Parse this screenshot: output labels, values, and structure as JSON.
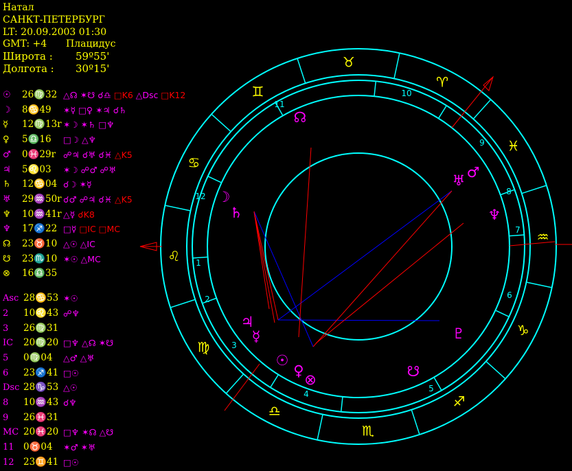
{
  "header": {
    "chart_kind": "Натал",
    "city": "САНКТ-ПЕТЕРБУРГ",
    "lt": "LT: 20.09.2003  01:30",
    "gmt": "GMT: +4",
    "house_system": "Плацидус",
    "lat_label": "Широта :",
    "lat_value": "59º55'",
    "lon_label": "Долгота :",
    "lon_value": "30º15'"
  },
  "planets": [
    {
      "glyph": "☉",
      "pos": "26♍32",
      "color": "#ff00ff",
      "aspects": [
        [
          "△☊",
          "#ff00ff"
        ],
        [
          "✶☋",
          "#ff00ff"
        ],
        [
          "☌♎",
          "#ff00ff"
        ],
        [
          "□K6",
          "#ff0000"
        ],
        [
          "△Dsc",
          "#ff00ff"
        ],
        [
          "□K12",
          "#ff0000"
        ]
      ]
    },
    {
      "glyph": "☽",
      "pos": "8♋49",
      "color": "#ff00ff",
      "aspects": [
        [
          "✶☿",
          "#ff00ff"
        ],
        [
          "□♀",
          "#ff00ff"
        ],
        [
          "✶♃",
          "#ff00ff"
        ],
        [
          "☌♄",
          "#ff00ff"
        ]
      ]
    },
    {
      "glyph": "☿",
      "pos": "12♍13r",
      "color": "#ffff00",
      "aspects": [
        [
          "✶☽",
          "#ff00ff"
        ],
        [
          "✶♄",
          "#ff00ff"
        ],
        [
          "□♆",
          "#ff00ff"
        ]
      ]
    },
    {
      "glyph": "♀",
      "pos": "5♎16",
      "color": "#ffff00",
      "aspects": [
        [
          "□☽",
          "#ff00ff"
        ],
        [
          "△♆",
          "#ff00ff"
        ]
      ]
    },
    {
      "glyph": "♂",
      "pos": "0♓29r",
      "color": "#ff00ff",
      "aspects": [
        [
          "☍♃",
          "#ff00ff"
        ],
        [
          "☌♅",
          "#ff00ff"
        ],
        [
          "☌♓",
          "#ff00ff"
        ],
        [
          "△K5",
          "#ff0000"
        ]
      ]
    },
    {
      "glyph": "♃",
      "pos": "5♌03",
      "color": "#ff00ff",
      "aspects": [
        [
          "✶☽",
          "#ff00ff"
        ],
        [
          "☍♂",
          "#ff00ff"
        ],
        [
          "☍♅",
          "#ff00ff"
        ]
      ]
    },
    {
      "glyph": "♄",
      "pos": "12♋04",
      "color": "#ffff00",
      "aspects": [
        [
          "☌☽",
          "#ff00ff"
        ],
        [
          "✶☿",
          "#ff00ff"
        ]
      ]
    },
    {
      "glyph": "♅",
      "pos": "29♒50r",
      "color": "#ff00ff",
      "aspects": [
        [
          "☌♂",
          "#ff00ff"
        ],
        [
          "☍♃",
          "#ff00ff"
        ],
        [
          "☌♓",
          "#ff00ff"
        ],
        [
          "△K5",
          "#ff0000"
        ]
      ]
    },
    {
      "glyph": "♆",
      "pos": "10♒41r",
      "color": "#ffff00",
      "aspects": [
        [
          "△☿",
          "#ff00ff"
        ],
        [
          "☌K8",
          "#ff0000"
        ]
      ]
    },
    {
      "glyph": "♆",
      "pos": "17♐22",
      "color": "#ff00ff",
      "aspects": [
        [
          "□☿",
          "#ff00ff"
        ],
        [
          "□IC",
          "#ff0000"
        ],
        [
          "□MC",
          "#ff0000"
        ]
      ]
    },
    {
      "glyph": "☊",
      "pos": "23♉10",
      "color": "#ffff00",
      "aspects": [
        [
          "△☉",
          "#ff00ff"
        ],
        [
          "△IC",
          "#ff00ff"
        ]
      ]
    },
    {
      "glyph": "☋",
      "pos": "23♏10",
      "color": "#ffff00",
      "aspects": [
        [
          "✶☉",
          "#ff00ff"
        ],
        [
          "△MC",
          "#ff00ff"
        ]
      ]
    },
    {
      "glyph": "⊗",
      "pos": "16♎35",
      "color": "#ffff00",
      "aspects": []
    }
  ],
  "cusps": [
    {
      "label": "Asc",
      "pos": "28♋53",
      "color": "#ff00ff",
      "aspects": [
        [
          "✶☉",
          "#ff00ff"
        ]
      ]
    },
    {
      "label": "2",
      "pos": "10♌43",
      "color": "#ff00ff",
      "aspects": [
        [
          "☍♆",
          "#ff00ff"
        ]
      ]
    },
    {
      "label": "3",
      "pos": "26♍31",
      "color": "#ff00ff",
      "aspects": []
    },
    {
      "label": "IC",
      "pos": "20♍20",
      "color": "#ff00ff",
      "aspects": [
        [
          "□♆",
          "#ff00ff"
        ],
        [
          "△☊",
          "#ff00ff"
        ],
        [
          "✶☋",
          "#ff00ff"
        ]
      ]
    },
    {
      "label": "5",
      "pos": "0♍04",
      "color": "#ff00ff",
      "aspects": [
        [
          "△♂",
          "#ff00ff"
        ],
        [
          "△♅",
          "#ff00ff"
        ]
      ]
    },
    {
      "label": "6",
      "pos": "23♐41",
      "color": "#ff00ff",
      "aspects": [
        [
          "□☉",
          "#ff00ff"
        ]
      ]
    },
    {
      "label": "Dsc",
      "pos": "28♑53",
      "color": "#ff00ff",
      "aspects": [
        [
          "△☉",
          "#ff00ff"
        ]
      ]
    },
    {
      "label": "8",
      "pos": "10♒43",
      "color": "#ff00ff",
      "aspects": [
        [
          "☌♆",
          "#ff00ff"
        ]
      ]
    },
    {
      "label": "9",
      "pos": "26♓31",
      "color": "#ff00ff",
      "aspects": []
    },
    {
      "label": "MC",
      "pos": "20♓20",
      "color": "#ff00ff",
      "aspects": [
        [
          "□♆",
          "#ff00ff"
        ],
        [
          "✶☊",
          "#ff00ff"
        ],
        [
          "△☋",
          "#ff00ff"
        ]
      ]
    },
    {
      "label": "11",
      "pos": "0♉04",
      "color": "#ff00ff",
      "aspects": [
        [
          "✶♂",
          "#ff00ff"
        ],
        [
          "✶♅",
          "#ff00ff"
        ]
      ]
    },
    {
      "label": "12",
      "pos": "23♊41",
      "color": "#ff00ff",
      "aspects": [
        [
          "□☉",
          "#ff00ff"
        ]
      ]
    }
  ],
  "wheel": {
    "signs": [
      {
        "glyph": "♉",
        "color": "#ffff00"
      },
      {
        "glyph": "♈",
        "color": "#ffff00"
      },
      {
        "glyph": "♓",
        "color": "#ffff00"
      },
      {
        "glyph": "♒",
        "color": "#ffff00"
      },
      {
        "glyph": "♑",
        "color": "#ffff00"
      },
      {
        "glyph": "♐",
        "color": "#ffff00"
      },
      {
        "glyph": "♏",
        "color": "#ffff00"
      },
      {
        "glyph": "♎",
        "color": "#ffff00"
      },
      {
        "glyph": "♍",
        "color": "#ffff00"
      },
      {
        "glyph": "♌",
        "color": "#ffff00"
      },
      {
        "glyph": "♋",
        "color": "#ffff00"
      },
      {
        "glyph": "♊",
        "color": "#ffff00"
      }
    ],
    "house_numbers": [
      "1",
      "2",
      "3",
      "4",
      "5",
      "6",
      "7",
      "8",
      "9",
      "10",
      "11",
      "12"
    ],
    "planet_glyphs": [
      {
        "name": "node",
        "glyph": "☊",
        "color": "#ff00ff"
      },
      {
        "name": "moon",
        "glyph": "☽",
        "color": "#ff00ff"
      },
      {
        "name": "saturn",
        "glyph": "♄",
        "color": "#ff00ff"
      },
      {
        "name": "uranus",
        "glyph": "♅",
        "color": "#ff00ff"
      },
      {
        "name": "mars",
        "glyph": "♂",
        "color": "#ff00ff"
      },
      {
        "name": "neptune",
        "glyph": "♆",
        "color": "#ff00ff"
      },
      {
        "name": "jupiter",
        "glyph": "♃",
        "color": "#ff00ff"
      },
      {
        "name": "mercury",
        "glyph": "☿",
        "color": "#ff00ff"
      },
      {
        "name": "sun",
        "glyph": "☉",
        "color": "#ff00ff"
      },
      {
        "name": "venus",
        "glyph": "♀",
        "color": "#ff00ff"
      },
      {
        "name": "fortune",
        "glyph": "⊗",
        "color": "#ff00ff"
      },
      {
        "name": "south-node",
        "glyph": "☋",
        "color": "#ff00ff"
      },
      {
        "name": "pluto",
        "glyph": "♇",
        "color": "#ff00ff"
      }
    ],
    "ring_color": "#00ffff",
    "house_number_color": "#00ffff",
    "axis_color": "#ff0000"
  }
}
